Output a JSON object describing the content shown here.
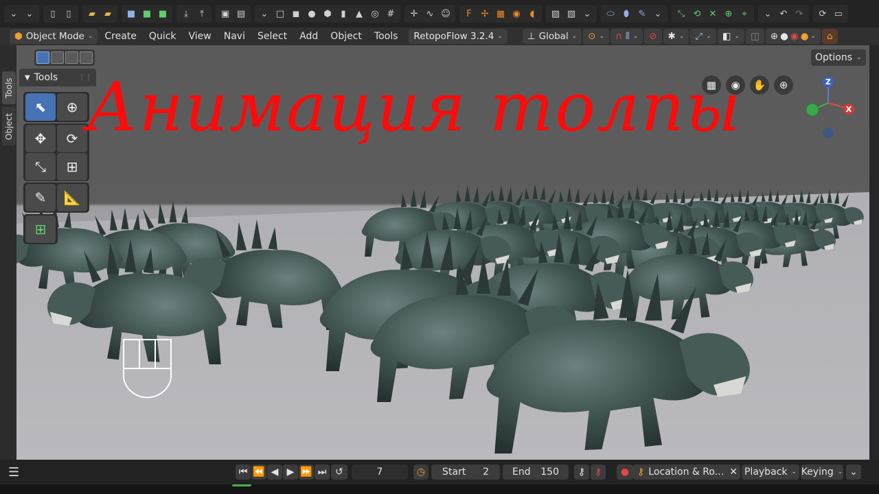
{
  "colors": {
    "accent": "#4772b3",
    "title_red": "#ff0a0a",
    "creature": "#3f524f"
  },
  "header": {
    "mode_label": "Object Mode",
    "menus": [
      "Create",
      "Quick",
      "View",
      "Navi",
      "Select",
      "Add",
      "Object",
      "Tools"
    ],
    "addon_label": "RetopoFlow 3.2.4",
    "orientation_label": "Global"
  },
  "sidebar": {
    "tabs": [
      "Tools",
      "Object"
    ]
  },
  "tools_panel": {
    "title": "Tools"
  },
  "options": {
    "label": "Options"
  },
  "overlay": {
    "title": "Анимация толпы"
  },
  "gizmo": {
    "z": "Z",
    "x": "X"
  },
  "timeline": {
    "current_frame": "7",
    "start_label": "Start",
    "start_value": "2",
    "end_label": "End",
    "end_value": "150",
    "keying_set": "Location & Ro...",
    "playback_label": "Playback",
    "keying_label": "Keying"
  }
}
